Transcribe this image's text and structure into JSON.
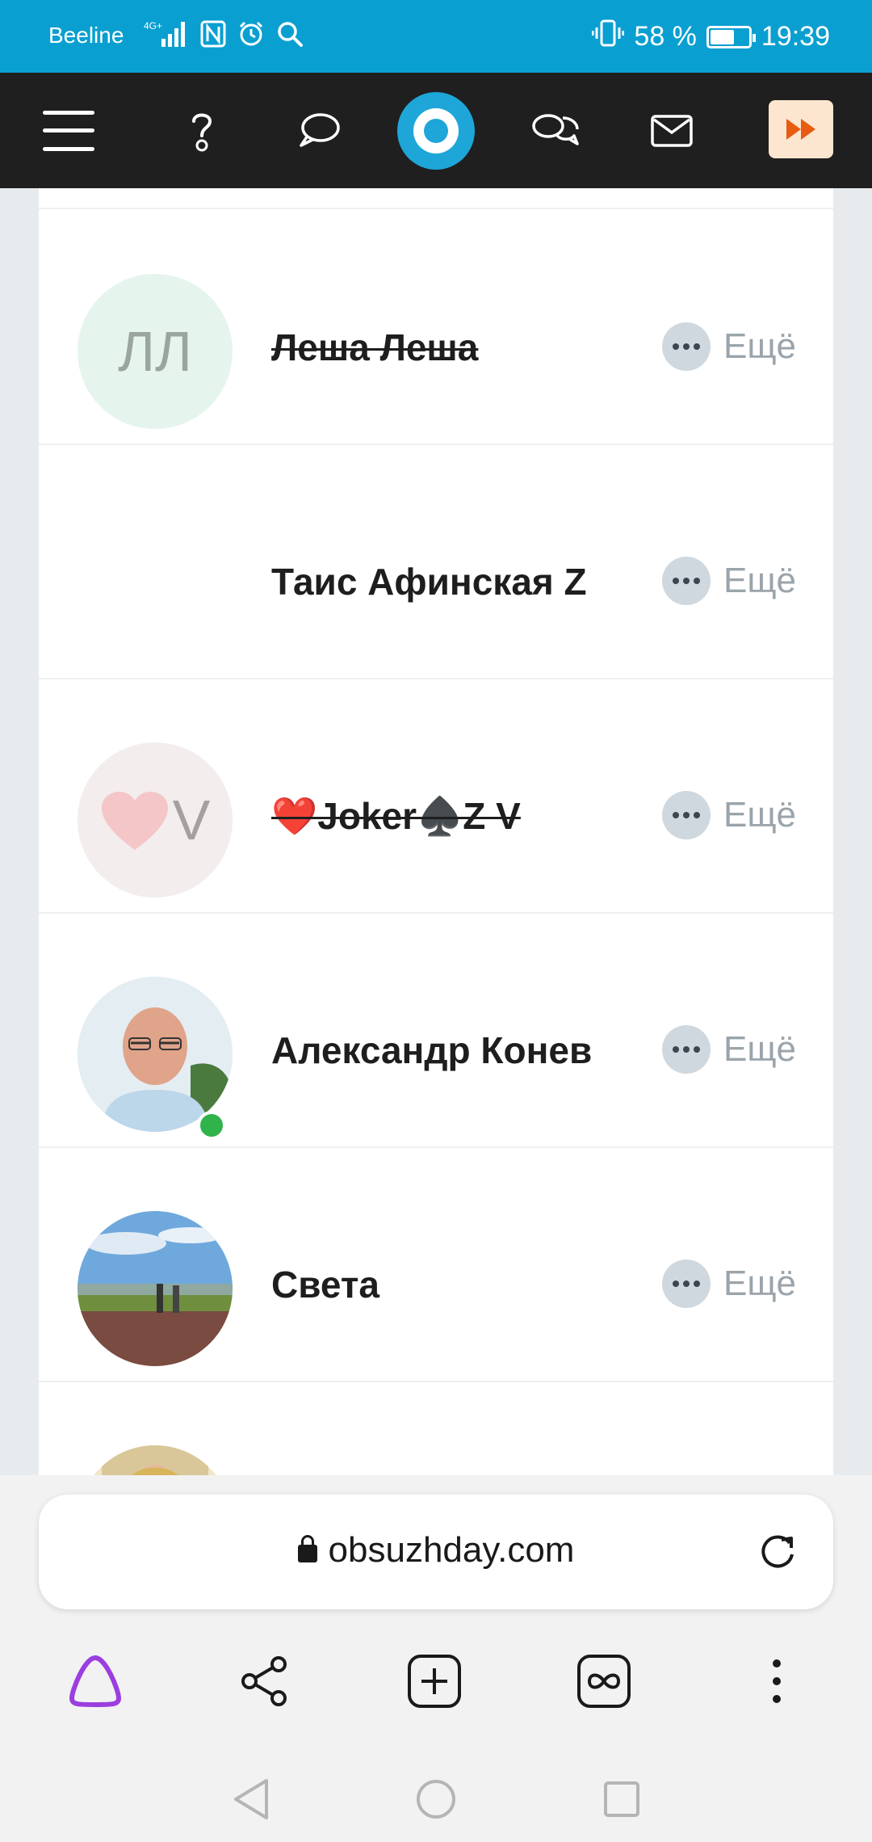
{
  "status_bar": {
    "carrier": "Beeline",
    "network": "4G+",
    "battery": "58 %",
    "battery_level": 0.58,
    "time": "19:39"
  },
  "header": {
    "icons": [
      "menu-icon",
      "question-icon",
      "chat-bubble-icon",
      "logo",
      "chats-icon",
      "mail-icon",
      "fast-forward-icon"
    ]
  },
  "users": [
    {
      "name": "Леша Леша",
      "initials": "ЛЛ",
      "avatar_color": "#e6f4ee",
      "initials_color": "#9aa5a0",
      "strikethrough": true,
      "more_label": "Ещё"
    },
    {
      "name": "Таис Афинская Z",
      "strikethrough": false,
      "more_label": "Ещё"
    },
    {
      "name": "❤️Joker♠️Z V",
      "initials": "V",
      "avatar_color": "#f3eded",
      "initials_color": "#a5a0a0",
      "strikethrough": true,
      "more_label": "Ещё"
    },
    {
      "name": "Александр Конев",
      "strikethrough": false,
      "online": true,
      "more_label": "Ещё"
    },
    {
      "name": "Света",
      "strikethrough": false,
      "more_label": "Ещё"
    }
  ],
  "browser": {
    "url": "obsuzhday.com"
  },
  "colors": {
    "status_bar": "#0a9fd1",
    "header": "#1f1f1f",
    "accent": "#1ea6d8",
    "online": "#2fb34a",
    "alice": "#9b3ee0"
  }
}
